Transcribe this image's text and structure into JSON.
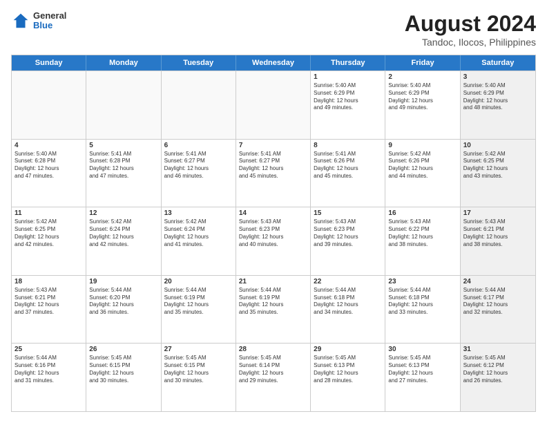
{
  "header": {
    "logo": {
      "general": "General",
      "blue": "Blue"
    },
    "title": "August 2024",
    "location": "Tandoc, Ilocos, Philippines"
  },
  "calendar": {
    "days": [
      "Sunday",
      "Monday",
      "Tuesday",
      "Wednesday",
      "Thursday",
      "Friday",
      "Saturday"
    ],
    "rows": [
      [
        {
          "day": "",
          "empty": true
        },
        {
          "day": "",
          "empty": true
        },
        {
          "day": "",
          "empty": true
        },
        {
          "day": "",
          "empty": true
        },
        {
          "day": "1",
          "lines": [
            "Sunrise: 5:40 AM",
            "Sunset: 6:29 PM",
            "Daylight: 12 hours",
            "and 49 minutes."
          ]
        },
        {
          "day": "2",
          "lines": [
            "Sunrise: 5:40 AM",
            "Sunset: 6:29 PM",
            "Daylight: 12 hours",
            "and 49 minutes."
          ]
        },
        {
          "day": "3",
          "shaded": true,
          "lines": [
            "Sunrise: 5:40 AM",
            "Sunset: 6:29 PM",
            "Daylight: 12 hours",
            "and 48 minutes."
          ]
        }
      ],
      [
        {
          "day": "4",
          "lines": [
            "Sunrise: 5:40 AM",
            "Sunset: 6:28 PM",
            "Daylight: 12 hours",
            "and 47 minutes."
          ]
        },
        {
          "day": "5",
          "lines": [
            "Sunrise: 5:41 AM",
            "Sunset: 6:28 PM",
            "Daylight: 12 hours",
            "and 47 minutes."
          ]
        },
        {
          "day": "6",
          "lines": [
            "Sunrise: 5:41 AM",
            "Sunset: 6:27 PM",
            "Daylight: 12 hours",
            "and 46 minutes."
          ]
        },
        {
          "day": "7",
          "lines": [
            "Sunrise: 5:41 AM",
            "Sunset: 6:27 PM",
            "Daylight: 12 hours",
            "and 45 minutes."
          ]
        },
        {
          "day": "8",
          "lines": [
            "Sunrise: 5:41 AM",
            "Sunset: 6:26 PM",
            "Daylight: 12 hours",
            "and 45 minutes."
          ]
        },
        {
          "day": "9",
          "lines": [
            "Sunrise: 5:42 AM",
            "Sunset: 6:26 PM",
            "Daylight: 12 hours",
            "and 44 minutes."
          ]
        },
        {
          "day": "10",
          "shaded": true,
          "lines": [
            "Sunrise: 5:42 AM",
            "Sunset: 6:25 PM",
            "Daylight: 12 hours",
            "and 43 minutes."
          ]
        }
      ],
      [
        {
          "day": "11",
          "lines": [
            "Sunrise: 5:42 AM",
            "Sunset: 6:25 PM",
            "Daylight: 12 hours",
            "and 42 minutes."
          ]
        },
        {
          "day": "12",
          "lines": [
            "Sunrise: 5:42 AM",
            "Sunset: 6:24 PM",
            "Daylight: 12 hours",
            "and 42 minutes."
          ]
        },
        {
          "day": "13",
          "lines": [
            "Sunrise: 5:42 AM",
            "Sunset: 6:24 PM",
            "Daylight: 12 hours",
            "and 41 minutes."
          ]
        },
        {
          "day": "14",
          "lines": [
            "Sunrise: 5:43 AM",
            "Sunset: 6:23 PM",
            "Daylight: 12 hours",
            "and 40 minutes."
          ]
        },
        {
          "day": "15",
          "lines": [
            "Sunrise: 5:43 AM",
            "Sunset: 6:23 PM",
            "Daylight: 12 hours",
            "and 39 minutes."
          ]
        },
        {
          "day": "16",
          "lines": [
            "Sunrise: 5:43 AM",
            "Sunset: 6:22 PM",
            "Daylight: 12 hours",
            "and 38 minutes."
          ]
        },
        {
          "day": "17",
          "shaded": true,
          "lines": [
            "Sunrise: 5:43 AM",
            "Sunset: 6:21 PM",
            "Daylight: 12 hours",
            "and 38 minutes."
          ]
        }
      ],
      [
        {
          "day": "18",
          "lines": [
            "Sunrise: 5:43 AM",
            "Sunset: 6:21 PM",
            "Daylight: 12 hours",
            "and 37 minutes."
          ]
        },
        {
          "day": "19",
          "lines": [
            "Sunrise: 5:44 AM",
            "Sunset: 6:20 PM",
            "Daylight: 12 hours",
            "and 36 minutes."
          ]
        },
        {
          "day": "20",
          "lines": [
            "Sunrise: 5:44 AM",
            "Sunset: 6:19 PM",
            "Daylight: 12 hours",
            "and 35 minutes."
          ]
        },
        {
          "day": "21",
          "lines": [
            "Sunrise: 5:44 AM",
            "Sunset: 6:19 PM",
            "Daylight: 12 hours",
            "and 35 minutes."
          ]
        },
        {
          "day": "22",
          "lines": [
            "Sunrise: 5:44 AM",
            "Sunset: 6:18 PM",
            "Daylight: 12 hours",
            "and 34 minutes."
          ]
        },
        {
          "day": "23",
          "lines": [
            "Sunrise: 5:44 AM",
            "Sunset: 6:18 PM",
            "Daylight: 12 hours",
            "and 33 minutes."
          ]
        },
        {
          "day": "24",
          "shaded": true,
          "lines": [
            "Sunrise: 5:44 AM",
            "Sunset: 6:17 PM",
            "Daylight: 12 hours",
            "and 32 minutes."
          ]
        }
      ],
      [
        {
          "day": "25",
          "lines": [
            "Sunrise: 5:44 AM",
            "Sunset: 6:16 PM",
            "Daylight: 12 hours",
            "and 31 minutes."
          ]
        },
        {
          "day": "26",
          "lines": [
            "Sunrise: 5:45 AM",
            "Sunset: 6:15 PM",
            "Daylight: 12 hours",
            "and 30 minutes."
          ]
        },
        {
          "day": "27",
          "lines": [
            "Sunrise: 5:45 AM",
            "Sunset: 6:15 PM",
            "Daylight: 12 hours",
            "and 30 minutes."
          ]
        },
        {
          "day": "28",
          "lines": [
            "Sunrise: 5:45 AM",
            "Sunset: 6:14 PM",
            "Daylight: 12 hours",
            "and 29 minutes."
          ]
        },
        {
          "day": "29",
          "lines": [
            "Sunrise: 5:45 AM",
            "Sunset: 6:13 PM",
            "Daylight: 12 hours",
            "and 28 minutes."
          ]
        },
        {
          "day": "30",
          "lines": [
            "Sunrise: 5:45 AM",
            "Sunset: 6:13 PM",
            "Daylight: 12 hours",
            "and 27 minutes."
          ]
        },
        {
          "day": "31",
          "shaded": true,
          "lines": [
            "Sunrise: 5:45 AM",
            "Sunset: 6:12 PM",
            "Daylight: 12 hours",
            "and 26 minutes."
          ]
        }
      ]
    ]
  }
}
